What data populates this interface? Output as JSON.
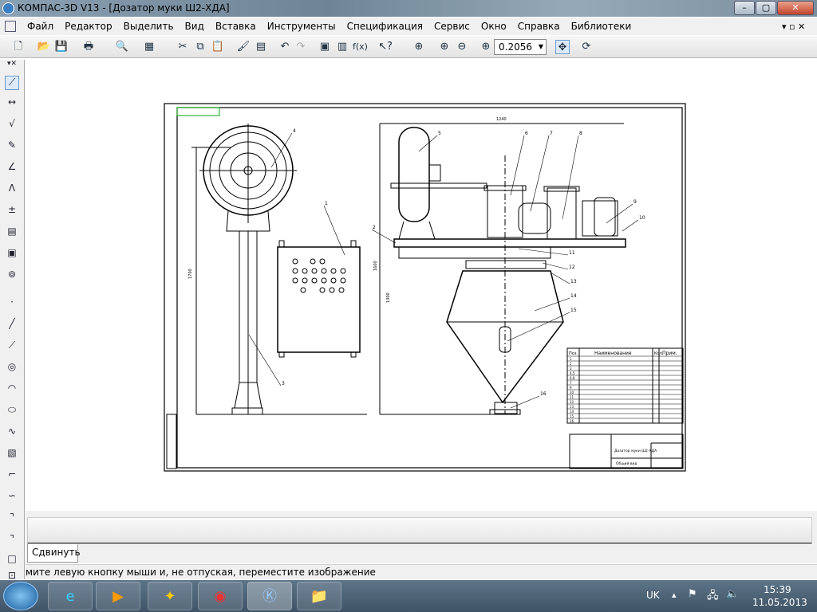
{
  "window": {
    "title": "КОМПАС-3D V13 - [Дозатор муки Ш2-ХДА]",
    "minimize": "–",
    "maximize": "▢",
    "close": "✕"
  },
  "menu": [
    "Файл",
    "Редактор",
    "Выделить",
    "Вид",
    "Вставка",
    "Инструменты",
    "Спецификация",
    "Сервис",
    "Окно",
    "Справка",
    "Библиотеки"
  ],
  "toolbar": {
    "zoom_value": "0.2056"
  },
  "drawing": {
    "positions": [
      "1",
      "2",
      "3",
      "4",
      "5",
      "6",
      "7",
      "8",
      "9",
      "10",
      "11",
      "12",
      "13",
      "14",
      "15",
      "16"
    ],
    "dimensions": [
      "1240",
      "1700",
      "1600",
      "1300"
    ],
    "spec_header": {
      "pos": "Поз.",
      "name": "Наименование",
      "qty": "Кол.",
      "note": "Прим."
    },
    "spec_rows": [
      "1",
      "2",
      "3",
      "4,5",
      "6,8",
      "7",
      "9",
      "10",
      "11",
      "12",
      "13",
      "14",
      "15",
      "16"
    ],
    "title_block": {
      "name": "Дозатор муки Ш2-ХДА",
      "sheet": "Общий вид"
    }
  },
  "panel": {
    "tab_label": "Сдвинуть"
  },
  "status": {
    "hint": "мите левую кнопку мыши и, не отпуская, переместите изображение"
  },
  "taskbar": {
    "lang": "UK",
    "time": "15:39",
    "date": "11.05.2013"
  },
  "colors": {
    "accent": "#3b7fc4",
    "taskbar": "#4a6072"
  }
}
